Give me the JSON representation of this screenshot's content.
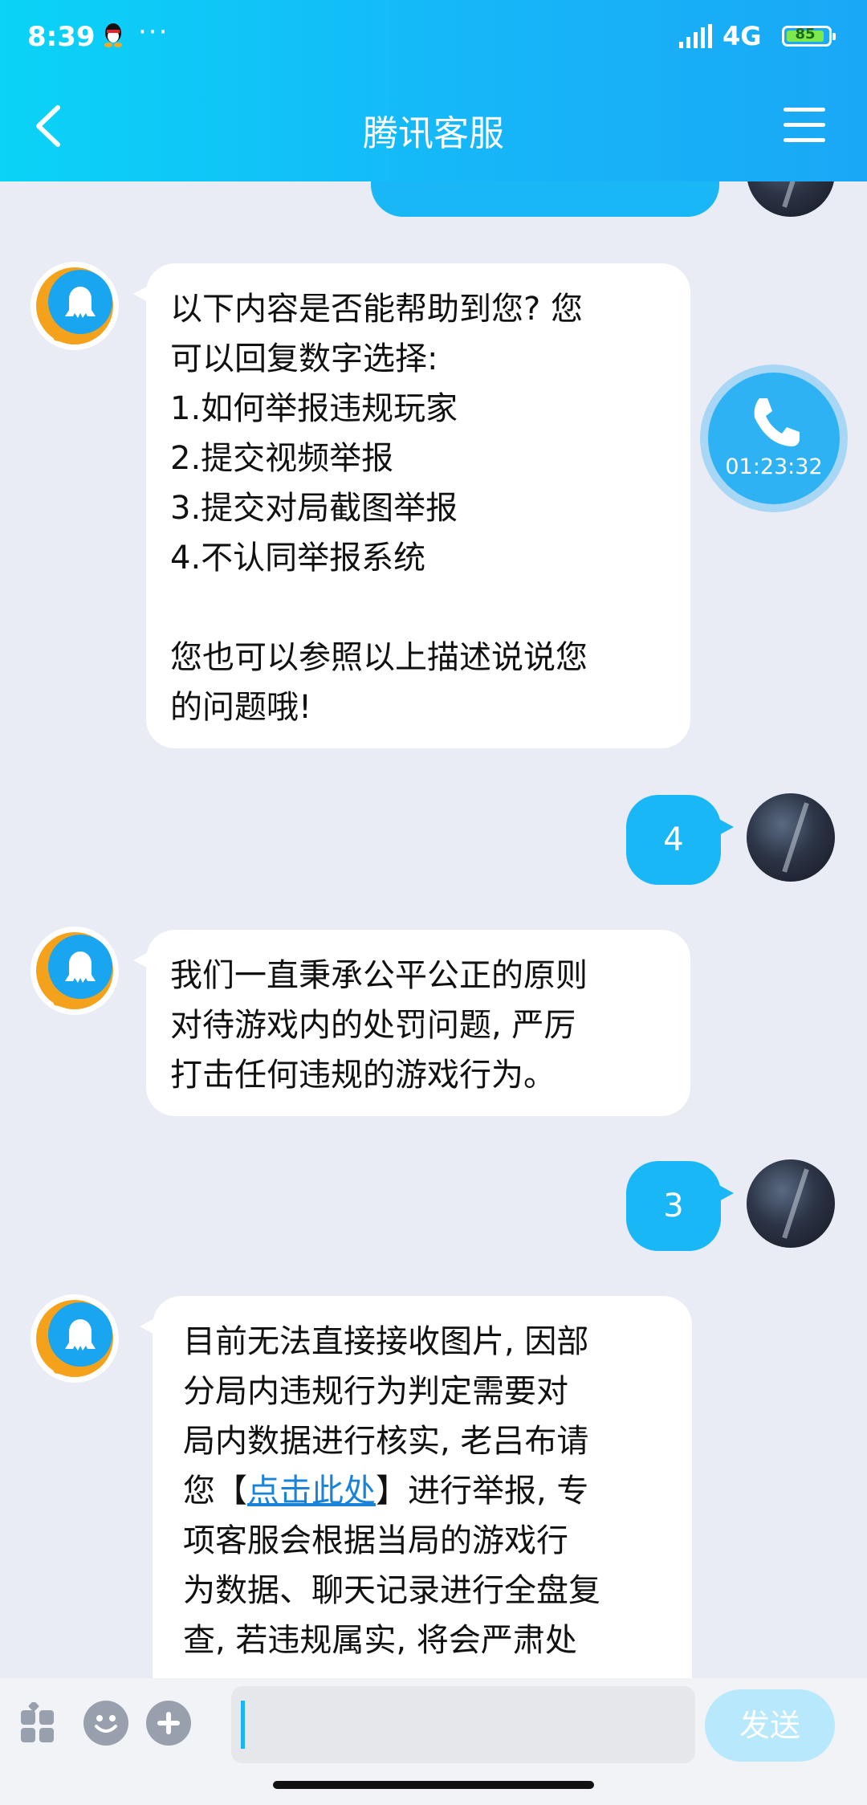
{
  "status_bar": {
    "time": "8:39",
    "dots": "···",
    "network": "4G",
    "battery": "85"
  },
  "header": {
    "title": "腾讯客服"
  },
  "call_float": {
    "duration": "01:23:32"
  },
  "messages": [
    {
      "sender": "bot",
      "lines": [
        "以下内容是否能帮助到您? 您",
        "可以回复数字选择:",
        "1.如何举报违规玩家",
        "2.提交视频举报",
        "3.提交对局截图举报",
        "4.不认同举报系统",
        "",
        "您也可以参照以上描述说说您",
        "的问题哦!"
      ]
    },
    {
      "sender": "user",
      "text": "4"
    },
    {
      "sender": "bot",
      "lines": [
        "我们一直秉承公平公正的原则",
        "对待游戏内的处罚问题, 严厉",
        "打击任何违规的游戏行为。"
      ]
    },
    {
      "sender": "user",
      "text": "3"
    },
    {
      "sender": "bot",
      "lines_before": [
        "目前无法直接接收图片, 因部",
        "分局内违规行为判定需要对",
        "局内数据进行核实, 老吕布请"
      ],
      "link_prefix": "您【",
      "link_text": "点击此处",
      "link_suffix": "】进行举报, 专",
      "lines_after": [
        "项客服会根据当局的游戏行",
        "为数据、聊天记录进行全盘复",
        "查, 若违规属实, 将会严肃处"
      ]
    }
  ],
  "input_bar": {
    "placeholder": "",
    "send_label": "发送"
  },
  "icons": {
    "back": "chevron-left-icon",
    "menu": "hamburger-icon",
    "call": "phone-icon",
    "apps": "apps-icon",
    "emoji": "emoji-icon",
    "plus": "plus-icon"
  },
  "colors": {
    "header_start": "#0ad3f7",
    "header_end": "#1aa8f6",
    "bubble_user": "#19b7f6",
    "link": "#1a83d8",
    "send_disabled": "#b8e8fb"
  }
}
